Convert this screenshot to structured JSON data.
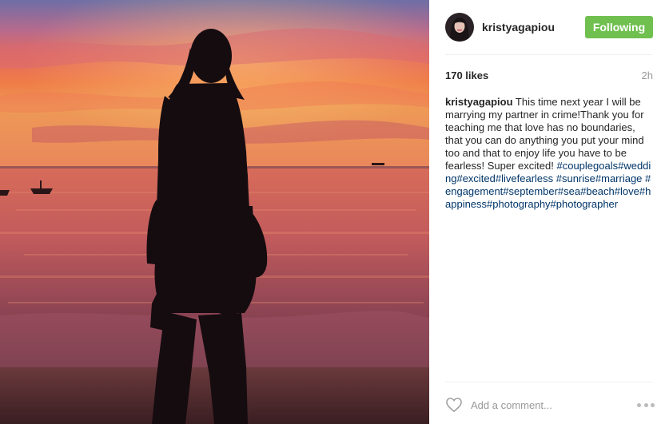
{
  "post": {
    "username": "kristyagapiou",
    "follow_label": "Following",
    "likes": "170 likes",
    "time": "2h",
    "caption": {
      "user": "kristyagapiou",
      "text": "This time next year I will be marrying my partner in crime!Thank you for teaching me that love has no boundaries, that you can do anything you put your mind too and that to enjoy life you have to be fearless! Super excited!",
      "hashtags": "#couplegoals#wedding#excited#livefearless #sunrise#marriage #engagement#september#sea#beach#love#happiness#photography#photographer"
    },
    "comment_placeholder": "Add a comment...",
    "colors": {
      "follow_button": "#70c050",
      "hashtag": "#003569"
    },
    "icons": {
      "like": "heart-outline-icon",
      "options": "more-dots-icon"
    },
    "photo": {
      "subject": "silhouette of a couple at sunset on a beach, woman sitting on man's shoulders"
    }
  }
}
